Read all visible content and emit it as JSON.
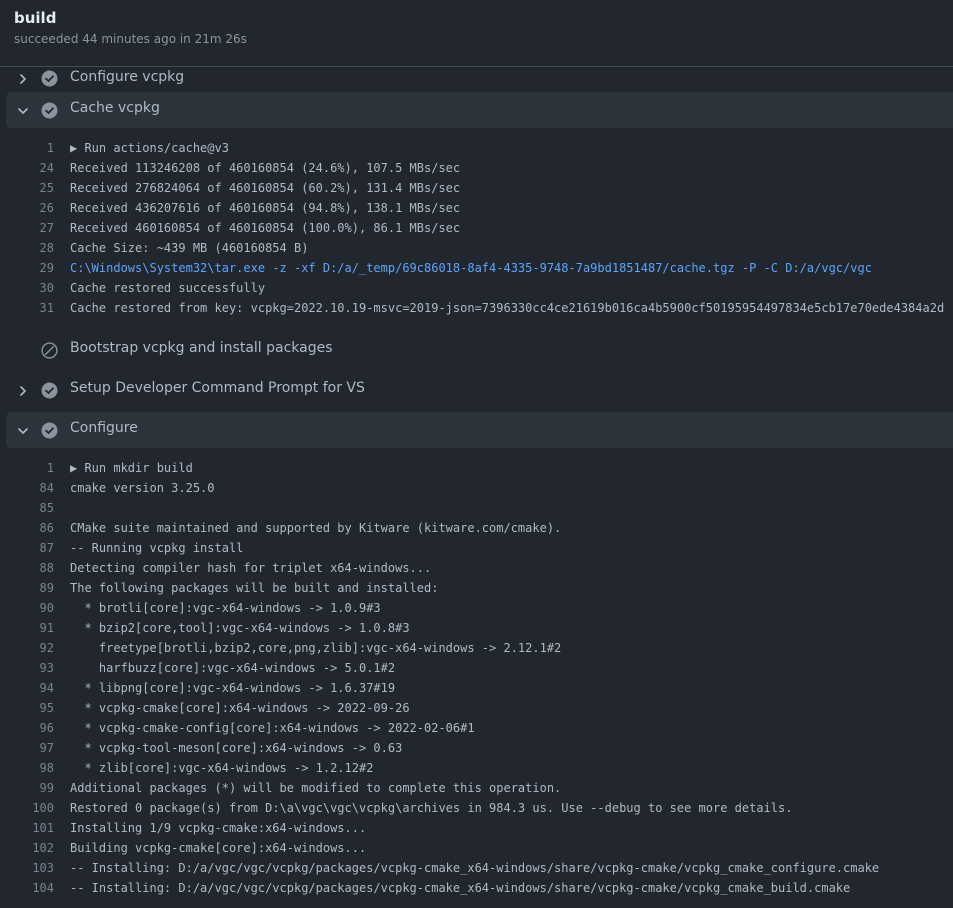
{
  "job": {
    "title": "build",
    "subtitle": "succeeded 44 minutes ago in 21m 26s"
  },
  "steps": [
    {
      "label": "Configure vcpkg",
      "status": "success",
      "expanded": false,
      "cut": true
    },
    {
      "label": "Cache vcpkg",
      "status": "success",
      "expanded": true,
      "log": [
        {
          "n": "1",
          "t": "▶ Run actions/cache@v3",
          "kind": "group"
        },
        {
          "n": "24",
          "t": "Received 113246208 of 460160854 (24.6%), 107.5 MBs/sec"
        },
        {
          "n": "25",
          "t": "Received 276824064 of 460160854 (60.2%), 131.4 MBs/sec"
        },
        {
          "n": "26",
          "t": "Received 436207616 of 460160854 (94.8%), 138.1 MBs/sec"
        },
        {
          "n": "27",
          "t": "Received 460160854 of 460160854 (100.0%), 86.1 MBs/sec"
        },
        {
          "n": "28",
          "t": "Cache Size: ~439 MB (460160854 B)"
        },
        {
          "n": "29",
          "t": "C:\\Windows\\System32\\tar.exe -z -xf D:/a/_temp/69c86018-8af4-4335-9748-7a9bd1851487/cache.tgz -P -C D:/a/vgc/vgc",
          "kind": "cmd"
        },
        {
          "n": "30",
          "t": "Cache restored successfully"
        },
        {
          "n": "31",
          "t": "Cache restored from key: vcpkg=2022.10.19-msvc=2019-json=7396330cc4ce21619b016ca4b5900cf50195954497834e5cb17e70ede4384a2d"
        }
      ]
    },
    {
      "label": "Bootstrap vcpkg and install packages",
      "status": "skipped",
      "expanded": false
    },
    {
      "label": "Setup Developer Command Prompt for VS",
      "status": "success",
      "expanded": false
    },
    {
      "label": "Configure",
      "status": "success",
      "expanded": true,
      "log": [
        {
          "n": "1",
          "t": "▶ Run mkdir build",
          "kind": "group"
        },
        {
          "n": "84",
          "t": "cmake version 3.25.0"
        },
        {
          "n": "85",
          "t": ""
        },
        {
          "n": "86",
          "t": "CMake suite maintained and supported by Kitware (kitware.com/cmake)."
        },
        {
          "n": "87",
          "t": "-- Running vcpkg install"
        },
        {
          "n": "88",
          "t": "Detecting compiler hash for triplet x64-windows..."
        },
        {
          "n": "89",
          "t": "The following packages will be built and installed:"
        },
        {
          "n": "90",
          "t": "  * brotli[core]:vgc-x64-windows -> 1.0.9#3"
        },
        {
          "n": "91",
          "t": "  * bzip2[core,tool]:vgc-x64-windows -> 1.0.8#3"
        },
        {
          "n": "92",
          "t": "    freetype[brotli,bzip2,core,png,zlib]:vgc-x64-windows -> 2.12.1#2"
        },
        {
          "n": "93",
          "t": "    harfbuzz[core]:vgc-x64-windows -> 5.0.1#2"
        },
        {
          "n": "94",
          "t": "  * libpng[core]:vgc-x64-windows -> 1.6.37#19"
        },
        {
          "n": "95",
          "t": "  * vcpkg-cmake[core]:x64-windows -> 2022-09-26"
        },
        {
          "n": "96",
          "t": "  * vcpkg-cmake-config[core]:x64-windows -> 2022-02-06#1"
        },
        {
          "n": "97",
          "t": "  * vcpkg-tool-meson[core]:x64-windows -> 0.63"
        },
        {
          "n": "98",
          "t": "  * zlib[core]:vgc-x64-windows -> 1.2.12#2"
        },
        {
          "n": "99",
          "t": "Additional packages (*) will be modified to complete this operation."
        },
        {
          "n": "100",
          "t": "Restored 0 package(s) from D:\\a\\vgc\\vgc\\vcpkg\\archives in 984.3 us. Use --debug to see more details."
        },
        {
          "n": "101",
          "t": "Installing 1/9 vcpkg-cmake:x64-windows..."
        },
        {
          "n": "102",
          "t": "Building vcpkg-cmake[core]:x64-windows..."
        },
        {
          "n": "103",
          "t": "-- Installing: D:/a/vgc/vgc/vcpkg/packages/vcpkg-cmake_x64-windows/share/vcpkg-cmake/vcpkg_cmake_configure.cmake"
        },
        {
          "n": "104",
          "t": "-- Installing: D:/a/vgc/vgc/vcpkg/packages/vcpkg-cmake_x64-windows/share/vcpkg-cmake/vcpkg_cmake_build.cmake"
        }
      ]
    }
  ],
  "colors": {
    "background": "#22272e",
    "expanded_step": "#2d333b",
    "status_icon": "#8b949e",
    "command_text": "#58a6ff"
  },
  "icons": {
    "chevron_expanded": "chevron-down-icon",
    "chevron_collapsed": "chevron-right-icon",
    "success": "check-circle-icon",
    "skipped": "skip-icon"
  }
}
